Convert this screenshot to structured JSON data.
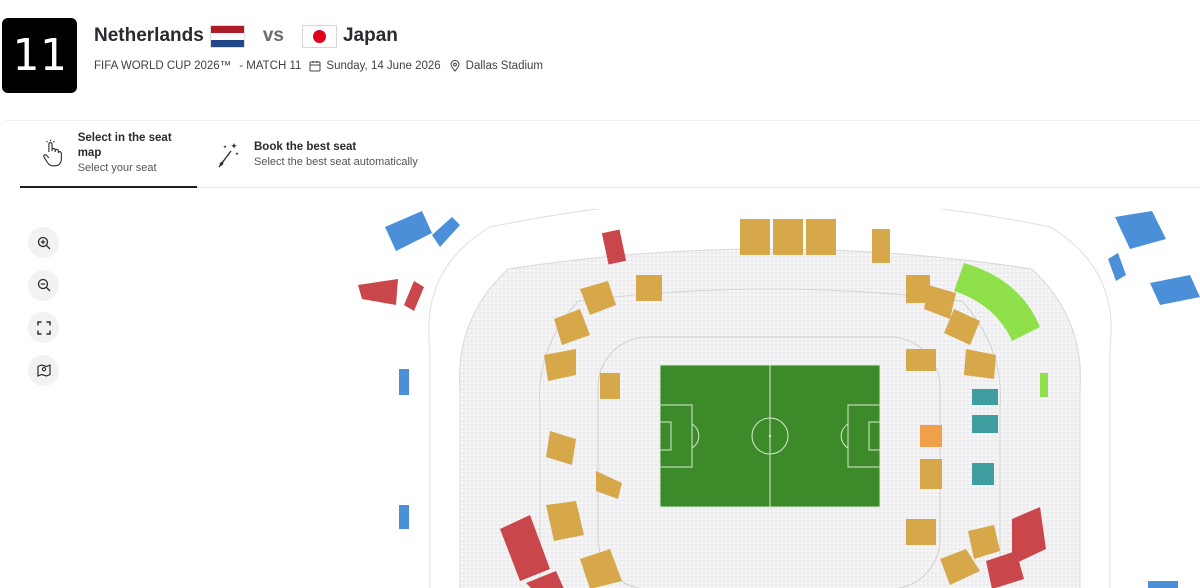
{
  "match": {
    "number": "11",
    "home_team": "Netherlands",
    "vs_label": "vs",
    "away_team": "Japan",
    "competition": "FIFA WORLD CUP 2026™",
    "match_label": "- MATCH 11",
    "date": "Sunday, 14 June 2026",
    "venue": "Dallas Stadium"
  },
  "tabs": [
    {
      "title": "Select in the seat map",
      "subtitle": "Select your seat",
      "icon": "hand-pointer-icon",
      "active": true
    },
    {
      "title": "Book the best seat",
      "subtitle": "Select the best seat automatically",
      "icon": "magic-wand-icon",
      "active": false
    }
  ],
  "tools": [
    "zoom-in-icon",
    "zoom-out-icon",
    "fullscreen-icon",
    "map-pin-icon"
  ],
  "colors": {
    "pitch": "#3c8a2a",
    "category_1": "#d6a84a",
    "category_red": "#c9474a",
    "category_blue": "#4a8fd8",
    "category_green": "#8fe04a",
    "category_teal": "#3f9ea0",
    "category_orange": "#f0a049",
    "unavailable": "#e6e6e8"
  }
}
